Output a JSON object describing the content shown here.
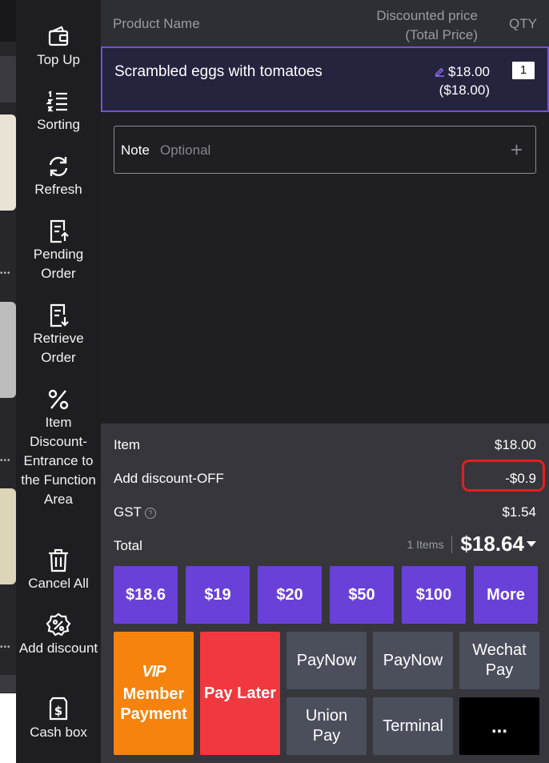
{
  "sidebar": {
    "items": [
      {
        "label": "Top Up",
        "icon": "wallet-icon"
      },
      {
        "label": "Sorting",
        "icon": "sort-list-icon"
      },
      {
        "label": "Refresh",
        "icon": "refresh-icon"
      },
      {
        "label": "Pending Order",
        "icon": "pending-order-icon"
      },
      {
        "label": "Retrieve Order",
        "icon": "retrieve-order-icon"
      },
      {
        "label": "Item Discount-Entrance to the Function Area",
        "icon": "percent-icon"
      },
      {
        "label": "Cancel All",
        "icon": "trash-icon"
      },
      {
        "label": "Add discount",
        "icon": "discount-badge-icon"
      },
      {
        "label": "Cash box",
        "icon": "cash-box-icon"
      }
    ]
  },
  "table": {
    "headers": {
      "product_name": "Product Name",
      "price_line1": "Discounted price",
      "price_line2": "(Total Price)",
      "qty": "QTY"
    },
    "rows": [
      {
        "name": "Scrambled eggs with tomatoes",
        "price": "$18.00",
        "total": "($18.00)",
        "qty": "1"
      }
    ]
  },
  "note": {
    "label": "Note",
    "placeholder": "Optional",
    "add_symbol": "+"
  },
  "summary": {
    "item_label": "Item",
    "item_value": "$18.00",
    "discount_label": "Add discount-OFF",
    "discount_value": "-$0.9",
    "gst_label": "GST",
    "gst_info": "?",
    "gst_value": "$1.54",
    "total_label": "Total",
    "items_count": "1 Items",
    "total_value": "$18.64"
  },
  "quick_amounts": [
    "$18.6",
    "$19",
    "$20",
    "$50",
    "$100",
    "More"
  ],
  "payments": {
    "member_logo": "VIP",
    "member_line1": "Member",
    "member_line2": "Payment",
    "pay_later": "Pay Later",
    "paynow_1": "PayNow",
    "paynow_2": "PayNow",
    "wechat_line1": "Wechat",
    "wechat_line2": "Pay",
    "union_line1": "Union",
    "union_line2": "Pay",
    "terminal": "Terminal",
    "more": "..."
  },
  "colors": {
    "accent": "#6a41d8",
    "selected_border": "#7650d8",
    "member": "#f6830e",
    "pay_later": "#f1383e",
    "highlight": "#e02020"
  }
}
